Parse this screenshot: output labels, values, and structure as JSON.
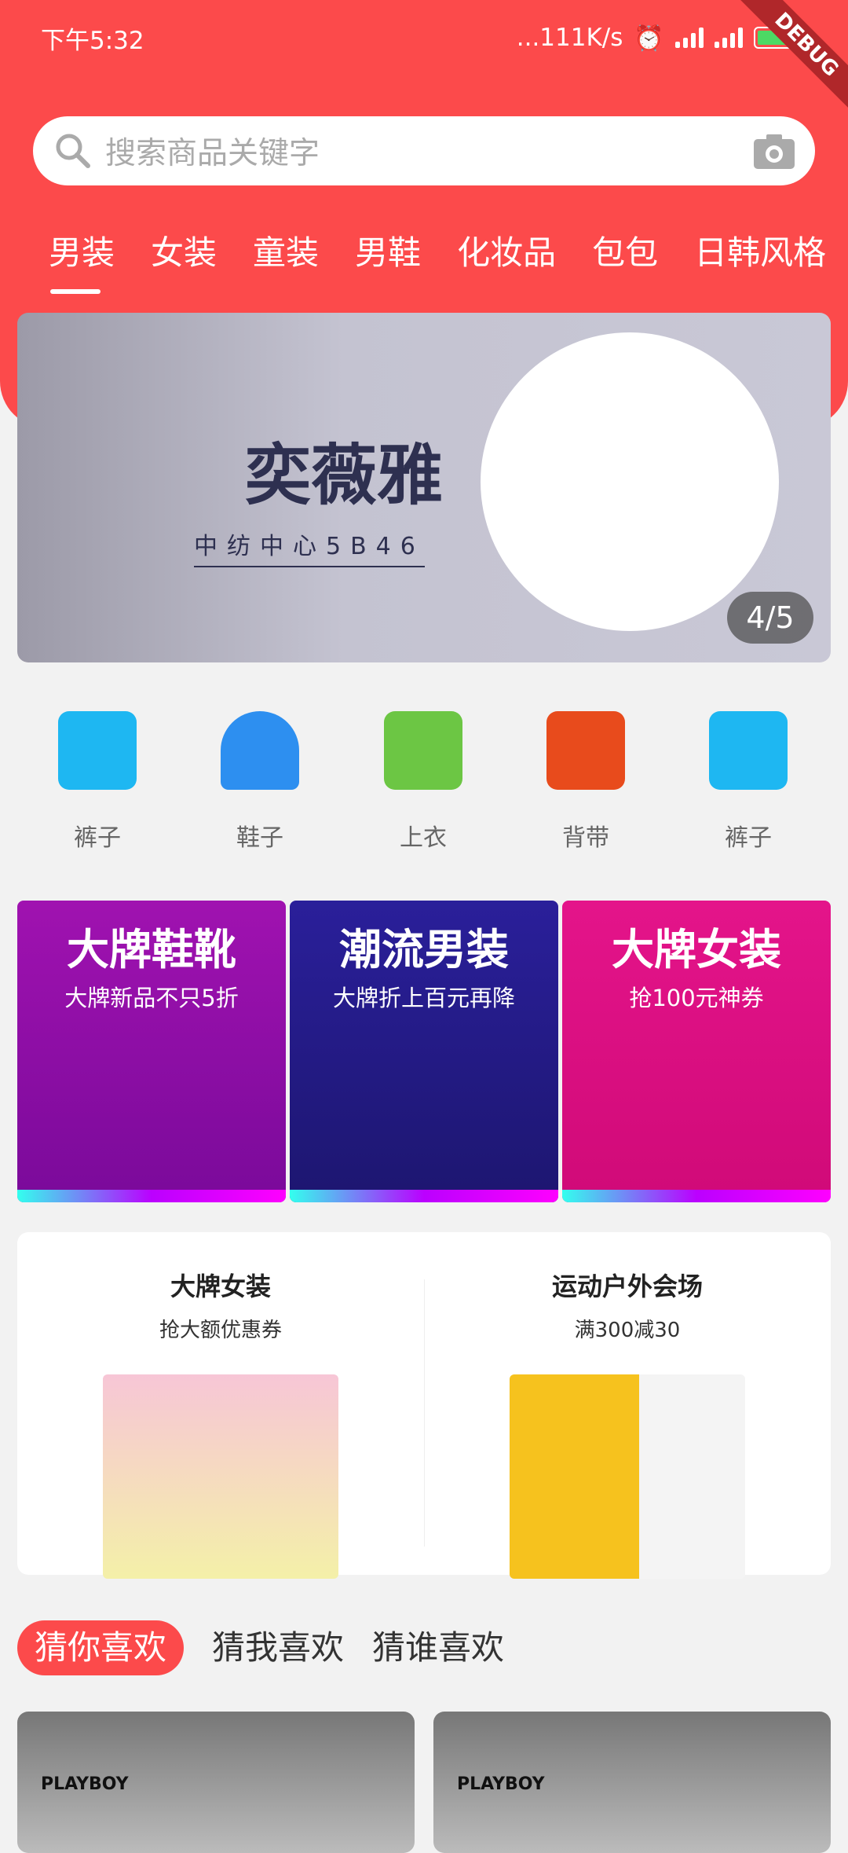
{
  "status_bar": {
    "time": "下午5:32",
    "speed": "...111K/s",
    "debug_ribbon": "DEBUG"
  },
  "search": {
    "placeholder": "搜索商品关键字"
  },
  "category_tabs": [
    {
      "label": "男装",
      "active": true
    },
    {
      "label": "女装"
    },
    {
      "label": "童装"
    },
    {
      "label": "男鞋"
    },
    {
      "label": "化妆品"
    },
    {
      "label": "包包"
    },
    {
      "label": "日韩风格"
    }
  ],
  "banner": {
    "brand": "奕薇雅",
    "subtitle": "中纺中心5B46",
    "indicator": "4/5"
  },
  "quick_icons": [
    {
      "label": "裤子",
      "color": "#1eb7f2"
    },
    {
      "label": "鞋子",
      "color": "#2d8ff0"
    },
    {
      "label": "上衣",
      "color": "#6cc644"
    },
    {
      "label": "背带",
      "color": "#e84b1c"
    },
    {
      "label": "裤子",
      "color": "#1eb7f2"
    }
  ],
  "promos": [
    {
      "title": "大牌鞋靴",
      "subtitle": "大牌新品不只5折",
      "color": "#a012b0"
    },
    {
      "title": "潮流男装",
      "subtitle": "大牌折上百元再降",
      "color": "#2a1f9a"
    },
    {
      "title": "大牌女装",
      "subtitle": "抢100元神券",
      "color": "#e4148a"
    }
  ],
  "venues": [
    {
      "title": "大牌女装",
      "subtitle": "抢大额优惠券"
    },
    {
      "title": "运动户外会场",
      "subtitle": "满300减30"
    }
  ],
  "guess_tabs": [
    {
      "label": "猜你喜欢",
      "active": true
    },
    {
      "label": "猜我喜欢"
    },
    {
      "label": "猜谁喜欢"
    }
  ],
  "products": [
    {
      "brand": "PLAYBOY"
    },
    {
      "brand": "PLAYBOY"
    }
  ],
  "colors": {
    "primary": "#fc4a4b",
    "background": "#f2f2f2"
  }
}
